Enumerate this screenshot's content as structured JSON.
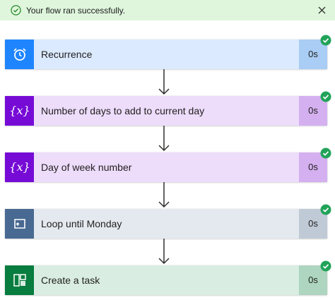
{
  "banner": {
    "message": "Your flow ran successfully.",
    "background": "#dff6dd",
    "icon": "check-circle-icon",
    "close_icon": "close-icon"
  },
  "steps": [
    {
      "title": "Recurrence",
      "duration": "0s",
      "icon": "alarm-clock-icon",
      "icon_color": "#1f85ff",
      "body_color": "#dbeafe",
      "duration_color": "#a9cdf5"
    },
    {
      "title": "Number of days to add to current day",
      "duration": "0s",
      "icon": "variable-icon",
      "icon_color": "#770bd6",
      "body_color": "#eddcfa",
      "duration_color": "#d4b0f0"
    },
    {
      "title": "Day of week number",
      "duration": "0s",
      "icon": "variable-icon",
      "icon_color": "#770bd6",
      "body_color": "#eddcfa",
      "duration_color": "#d4b0f0"
    },
    {
      "title": "Loop until Monday",
      "duration": "0s",
      "icon": "loop-icon",
      "icon_color": "#486991",
      "body_color": "#e4e9ef",
      "duration_color": "#c0cad6"
    },
    {
      "title": "Create a task",
      "duration": "0s",
      "icon": "planner-icon",
      "icon_color": "#077d3f",
      "body_color": "#d9ede2",
      "duration_color": "#add5bf"
    }
  ],
  "success_badge_color": "#22a35a"
}
